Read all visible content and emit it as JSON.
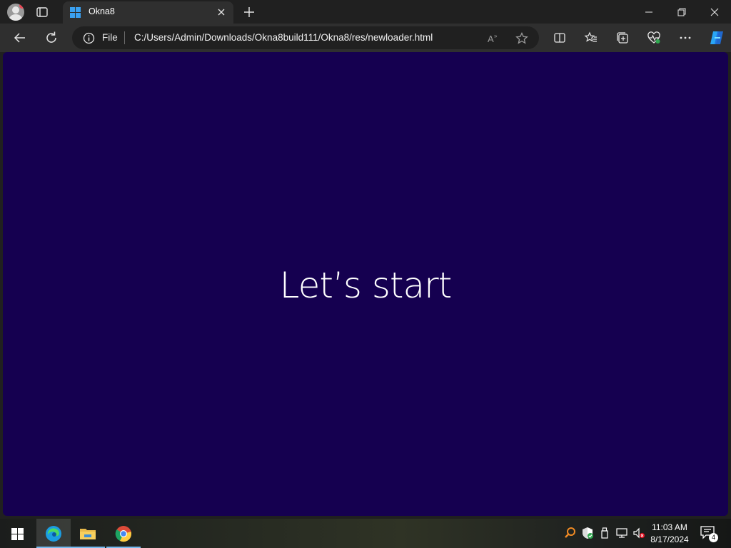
{
  "browser": {
    "tab": {
      "title": "Okna8",
      "favicon": "windows-logo-icon"
    },
    "address": {
      "scheme_label": "File",
      "url": "C:/Users/Admin/Downloads/Okna8build111/Okna8/res/newloader.html"
    }
  },
  "page": {
    "background": "#150050",
    "headline": "Let’s start"
  },
  "taskbar": {
    "apps": [
      {
        "name": "Microsoft Edge",
        "icon": "edge-icon",
        "active": true
      },
      {
        "name": "File Explorer",
        "icon": "folder-icon",
        "active": false
      },
      {
        "name": "Google Chrome",
        "icon": "chrome-icon",
        "active": false
      }
    ],
    "clock": {
      "time": "11:03 AM",
      "date": "8/17/2024"
    },
    "notification_count": "4"
  },
  "colors": {
    "accent": "#76b9ed",
    "page_background": "#150050",
    "chrome_dark": "#202020",
    "toolbar": "#2f2f2f"
  }
}
